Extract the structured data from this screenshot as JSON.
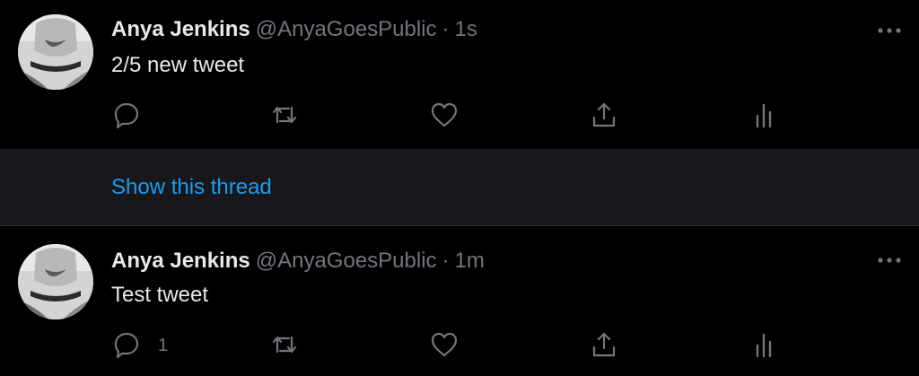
{
  "tweets": [
    {
      "author_name": "Anya Jenkins",
      "handle": "@AnyaGoesPublic",
      "separator": "·",
      "time": "1s",
      "text": "2/5 new tweet",
      "reply_count": ""
    },
    {
      "author_name": "Anya Jenkins",
      "handle": "@AnyaGoesPublic",
      "separator": "·",
      "time": "1m",
      "text": "Test tweet",
      "reply_count": "1"
    }
  ],
  "thread": {
    "show_label": "Show this thread"
  },
  "icons": {
    "reply": "reply-icon",
    "retweet": "retweet-icon",
    "like": "heart-icon",
    "share": "share-icon",
    "analytics": "analytics-icon",
    "more": "more-icon"
  },
  "colors": {
    "background": "#000000",
    "thread_background": "#16181c",
    "text_primary": "#e7e9ea",
    "text_secondary": "#71767b",
    "link": "#1d9bf0"
  }
}
